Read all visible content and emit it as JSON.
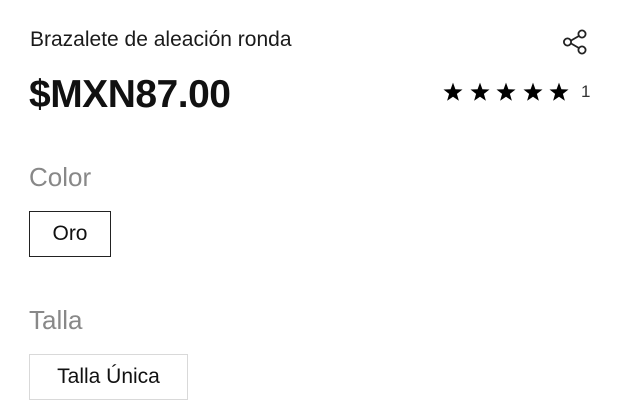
{
  "product": {
    "title": "Brazalete de aleación ronda",
    "price": "$MXN87.00",
    "rating": {
      "stars": 5,
      "max_stars": 5,
      "count": "1"
    }
  },
  "color": {
    "label": "Color",
    "options": [
      {
        "label": "Oro",
        "selected": true
      }
    ]
  },
  "size": {
    "label": "Talla",
    "options": [
      {
        "label": "Talla Única",
        "selected": false
      }
    ]
  },
  "icons": {
    "share": "share-icon",
    "star": "star-icon"
  },
  "colors": {
    "text": "#111111",
    "muted_label": "#888888",
    "selected_border": "#222222",
    "unselected_border": "#d9d9d9"
  }
}
